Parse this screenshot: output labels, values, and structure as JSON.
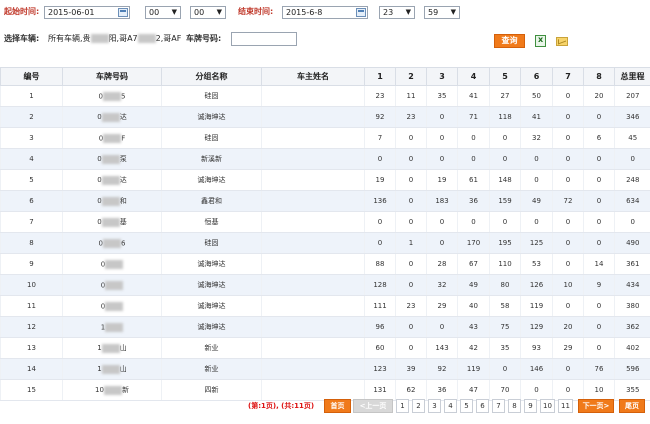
{
  "filters": {
    "start_label": "起始时间:",
    "start_date": "2015-06-01",
    "start_hour": "00",
    "start_minute": "00",
    "end_label": "结束时间:",
    "end_date": "2015-6-8",
    "end_hour": "23",
    "end_minute": "59",
    "vehicle_label": "选择车辆:",
    "vehicle_value_a": "所有车辆,贵",
    "vehicle_value_b": "阳,哥A7",
    "vehicle_value_c": "2,哥AF",
    "plate_label": "车牌号码:",
    "plate_value": "",
    "query_button": "查询",
    "excel_icon": "excel-export-icon",
    "mail_icon": "mail-icon"
  },
  "table": {
    "headers": [
      "编号",
      "车牌号码",
      "分组名称",
      "车主姓名",
      "1",
      "2",
      "3",
      "4",
      "5",
      "6",
      "7",
      "8",
      "总里程"
    ],
    "rows": [
      {
        "no": "1",
        "plate_pre": "0",
        "plate_suf": "5",
        "group": "硅固",
        "owner": "",
        "d": [
          "23",
          "11",
          "35",
          "41",
          "27",
          "50",
          "0",
          "20"
        ],
        "total": "207"
      },
      {
        "no": "2",
        "plate_pre": "0",
        "plate_suf": "达",
        "group": "诚海坤达",
        "owner": "",
        "d": [
          "92",
          "23",
          "0",
          "71",
          "118",
          "41",
          "0",
          "0"
        ],
        "total": "346"
      },
      {
        "no": "3",
        "plate_pre": "0",
        "plate_suf": "F",
        "group": "硅固",
        "owner": "",
        "d": [
          "7",
          "0",
          "0",
          "0",
          "0",
          "32",
          "0",
          "6"
        ],
        "total": "45"
      },
      {
        "no": "4",
        "plate_pre": "0",
        "plate_suf": "泵",
        "group": "新溪新",
        "owner": "",
        "d": [
          "0",
          "0",
          "0",
          "0",
          "0",
          "0",
          "0",
          "0"
        ],
        "total": "0"
      },
      {
        "no": "5",
        "plate_pre": "0",
        "plate_suf": "达",
        "group": "诚海坤达",
        "owner": "",
        "d": [
          "19",
          "0",
          "19",
          "61",
          "148",
          "0",
          "0",
          "0"
        ],
        "total": "248"
      },
      {
        "no": "6",
        "plate_pre": "0",
        "plate_suf": "和",
        "group": "鑫君和",
        "owner": "",
        "d": [
          "136",
          "0",
          "183",
          "36",
          "159",
          "49",
          "72",
          "0"
        ],
        "total": "634"
      },
      {
        "no": "7",
        "plate_pre": "0",
        "plate_suf": "基",
        "group": "恒基",
        "owner": "",
        "d": [
          "0",
          "0",
          "0",
          "0",
          "0",
          "0",
          "0",
          "0"
        ],
        "total": "0"
      },
      {
        "no": "8",
        "plate_pre": "0",
        "plate_suf": "6",
        "group": "硅固",
        "owner": "",
        "d": [
          "0",
          "1",
          "0",
          "170",
          "195",
          "125",
          "0",
          "0"
        ],
        "total": "490"
      },
      {
        "no": "9",
        "plate_pre": "0",
        "plate_suf": "",
        "group": "诚海坤达",
        "owner": "",
        "d": [
          "88",
          "0",
          "28",
          "67",
          "110",
          "53",
          "0",
          "14"
        ],
        "total": "361"
      },
      {
        "no": "10",
        "plate_pre": "0",
        "plate_suf": "",
        "group": "诚海坤达",
        "owner": "",
        "d": [
          "128",
          "0",
          "32",
          "49",
          "80",
          "126",
          "10",
          "9"
        ],
        "total": "434"
      },
      {
        "no": "11",
        "plate_pre": "0",
        "plate_suf": "",
        "group": "诚海坤达",
        "owner": "",
        "d": [
          "111",
          "23",
          "29",
          "40",
          "58",
          "119",
          "0",
          "0"
        ],
        "total": "380"
      },
      {
        "no": "12",
        "plate_pre": "1",
        "plate_suf": "",
        "group": "诚海坤达",
        "owner": "",
        "d": [
          "96",
          "0",
          "0",
          "43",
          "75",
          "129",
          "20",
          "0"
        ],
        "total": "362"
      },
      {
        "no": "13",
        "plate_pre": "1",
        "plate_suf": "山",
        "group": "新业",
        "owner": "",
        "d": [
          "60",
          "0",
          "143",
          "42",
          "35",
          "93",
          "29",
          "0"
        ],
        "total": "402"
      },
      {
        "no": "14",
        "plate_pre": "1",
        "plate_suf": "山",
        "group": "新业",
        "owner": "",
        "d": [
          "123",
          "39",
          "92",
          "119",
          "0",
          "146",
          "0",
          "76"
        ],
        "total": "596"
      },
      {
        "no": "15",
        "plate_pre": "10",
        "plate_suf": "新",
        "group": "四新",
        "owner": "",
        "d": [
          "131",
          "62",
          "36",
          "47",
          "70",
          "0",
          "0",
          "10"
        ],
        "total": "355"
      }
    ]
  },
  "pager": {
    "info": "(第:1页), (共:11页)",
    "first": "首页",
    "prev": "<上一页",
    "pages": [
      "1",
      "2",
      "3",
      "4",
      "5",
      "6",
      "7",
      "8",
      "9",
      "10",
      "11"
    ],
    "next": "下一页>",
    "last": "尾页"
  }
}
